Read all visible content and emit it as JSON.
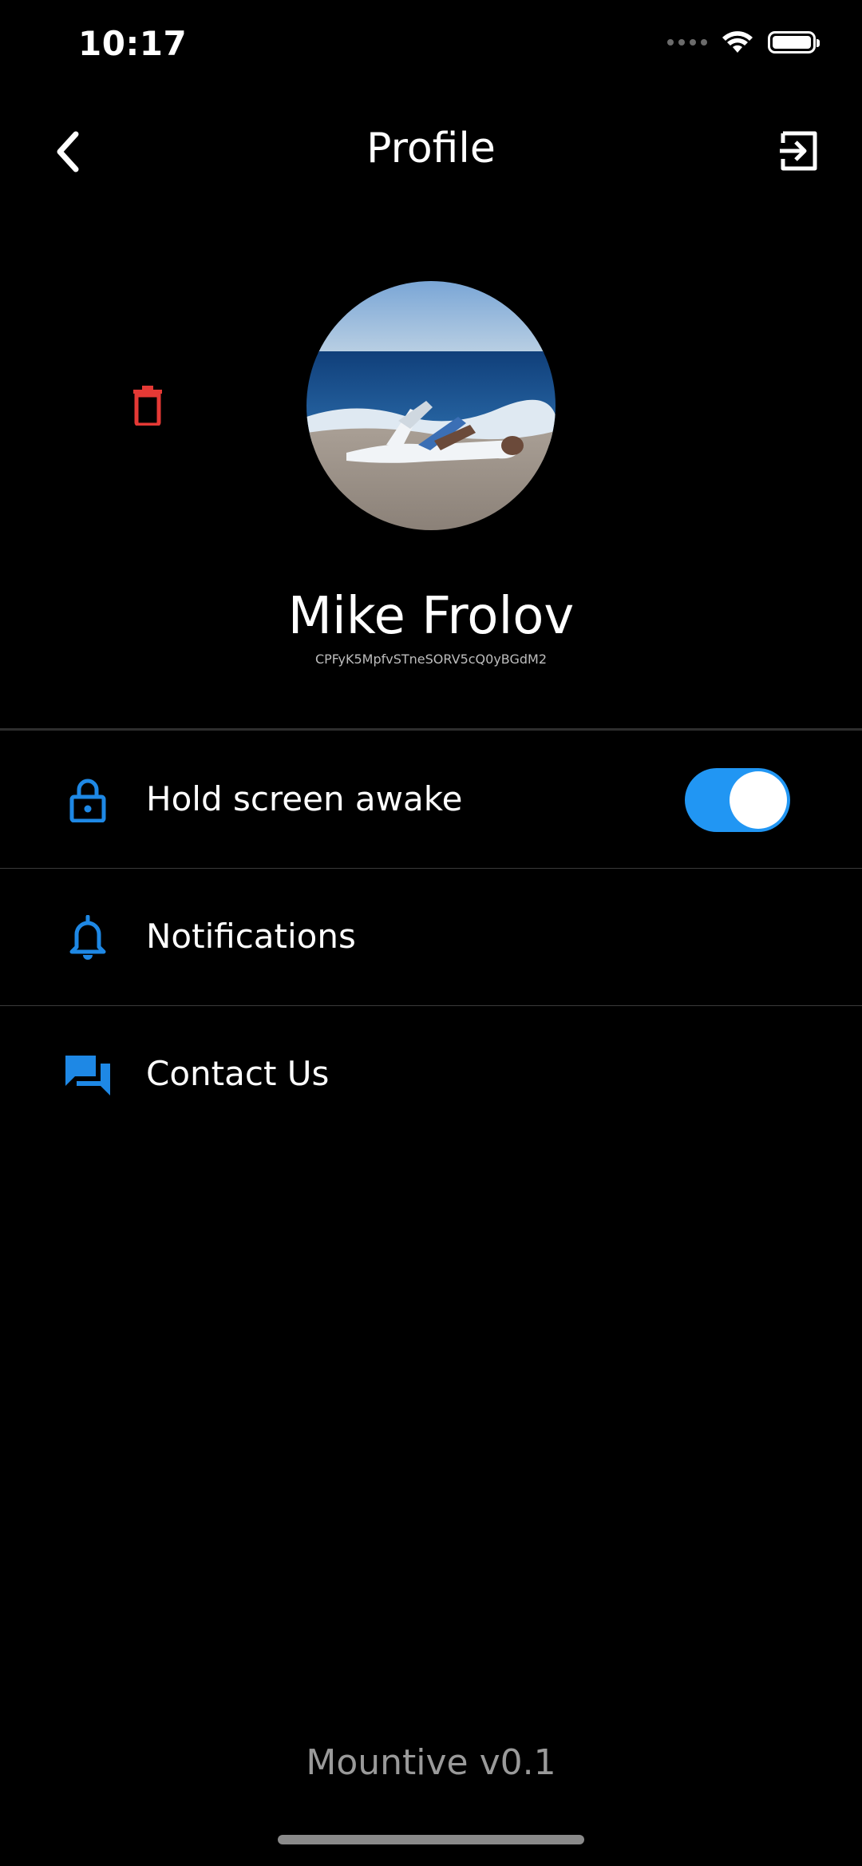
{
  "status_bar": {
    "time": "10:17",
    "icons": [
      "cellular-signal-icon",
      "wifi-icon",
      "battery-icon"
    ]
  },
  "nav": {
    "title": "Profile",
    "back_icon": "chevron-left-icon",
    "logout_icon": "logout-icon"
  },
  "profile": {
    "name": "Mike Frolov",
    "user_id": "CPFyK5MpfvSTneSORV5cQ0yBGdM2",
    "avatar": "beach-photo",
    "delete_icon": "trash-icon"
  },
  "settings": {
    "items": [
      {
        "label": "Hold screen awake",
        "icon": "lock-icon",
        "toggle_on": true
      },
      {
        "label": "Notifications",
        "icon": "bell-icon"
      },
      {
        "label": "Contact Us",
        "icon": "chat-icon"
      }
    ]
  },
  "footer": {
    "version": "Mountive v0.1"
  },
  "colors": {
    "background": "#000000",
    "accent_blue": "#1e88e5",
    "toggle_blue": "#2196f3",
    "delete_red": "#e53935",
    "text_primary": "#ffffff",
    "text_muted": "#9a9a9a"
  }
}
